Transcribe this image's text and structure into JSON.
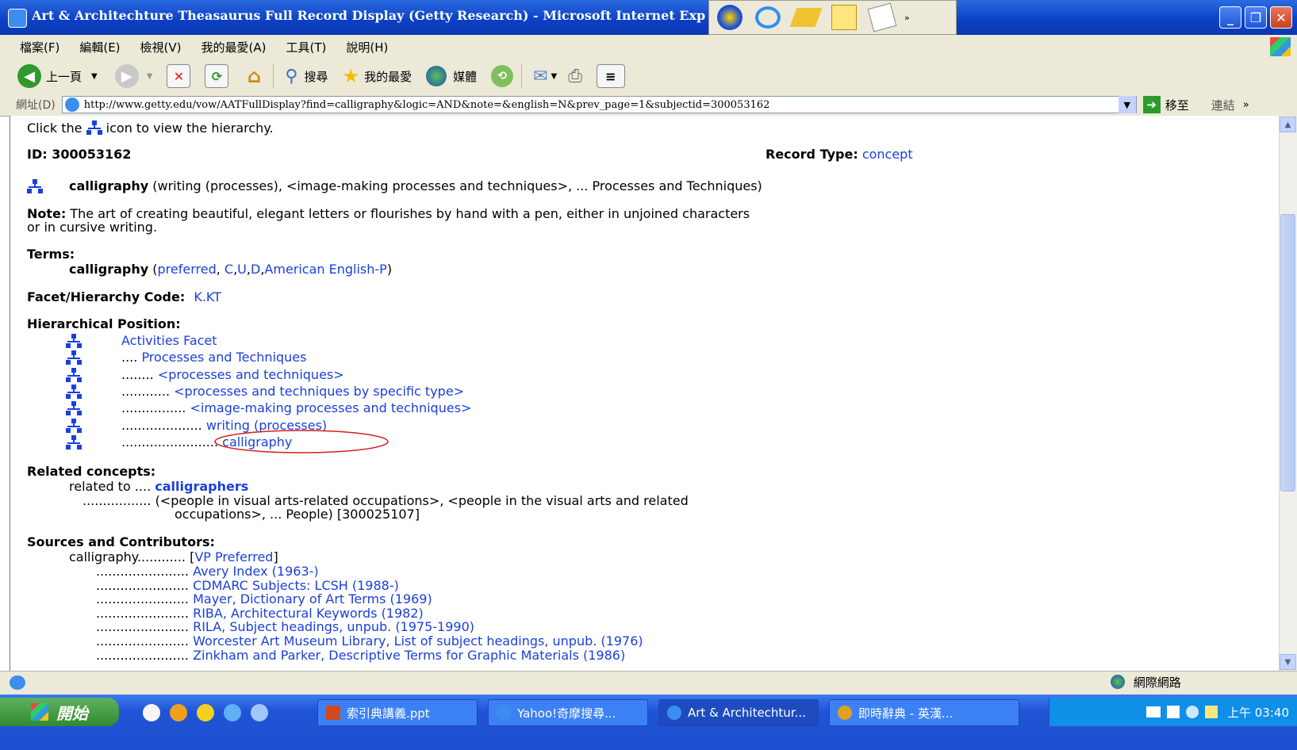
{
  "window": {
    "title": "Art & Architechture Theasaurus Full Record Display (Getty Research) - Microsoft Internet Exp"
  },
  "menu": [
    "檔案(F)",
    "編輯(E)",
    "檢視(V)",
    "我的最愛(A)",
    "工具(T)",
    "說明(H)"
  ],
  "toolbar": {
    "back": "上一頁",
    "search": "搜尋",
    "favorites": "我的最愛",
    "media": "媒體"
  },
  "address": {
    "label": "網址(D)",
    "url": "http://www.getty.edu/vow/AATFullDisplay?find=calligraphy&logic=AND&note=&english=N&prev_page=1&subjectid=300053162",
    "go": "移至",
    "links": "連結"
  },
  "record": {
    "intro_pre": "Click the",
    "intro_post": "icon to view the hierarchy.",
    "id_label": "ID: 300053162",
    "record_type_label": "Record Type:",
    "record_type_value": "concept",
    "heading_term": "calligraphy",
    "heading_context": "(writing (processes), <image-making processes and techniques>, ... Processes and Techniques)",
    "note_label": "Note:",
    "note_line1": "The art of creating beautiful, elegant letters or flourishes by hand with a pen, either in unjoined characters",
    "note_line2": "or in cursive writing.",
    "terms_label": "Terms:",
    "term": "calligraphy",
    "term_open": "(",
    "term_flags": [
      {
        "text": "preferred",
        "sep": ", "
      },
      {
        "text": "C",
        "sep": ","
      },
      {
        "text": "U",
        "sep": ","
      },
      {
        "text": "D",
        "sep": ","
      },
      {
        "text": "American English-P",
        "sep": ""
      }
    ],
    "term_close": ")",
    "facet_label": "Facet/Hierarchy Code:",
    "facet_code": "K.KT",
    "hier_label": "Hierarchical Position:",
    "hierarchy": [
      {
        "dots": "",
        "text": "Activities Facet"
      },
      {
        "dots": "....",
        "text": "Processes and Techniques"
      },
      {
        "dots": "........",
        "text": "<processes and techniques>"
      },
      {
        "dots": "............",
        "text": "<processes and techniques by specific type>"
      },
      {
        "dots": "................",
        "text": "<image-making processes and techniques>"
      },
      {
        "dots": "....................",
        "text": "writing (processes)"
      },
      {
        "dots": "........................",
        "text": "calligraphy"
      }
    ],
    "related_label": "Related concepts:",
    "related_to": "related to ....",
    "related_term": "calligraphers",
    "related_dots": ".................",
    "related_desc1": "(<people in visual arts-related occupations>, <people in the visual arts and related",
    "related_desc2": "occupations>, ... People) [300025107]",
    "sources_label": "Sources and Contributors:",
    "source_term": "calligraphy............",
    "source_pref_open": "[",
    "source_pref": "VP Preferred",
    "source_pref_close": "]",
    "sources": [
      {
        "dots": ".......................",
        "text": "Avery Index (1963-)"
      },
      {
        "dots": ".......................",
        "text": "CDMARC Subjects: LCSH (1988-)"
      },
      {
        "dots": ".......................",
        "text": "Mayer, Dictionary of Art Terms (1969)"
      },
      {
        "dots": ".......................",
        "text": "RIBA, Architectural Keywords (1982)"
      },
      {
        "dots": ".......................",
        "text": "RILA, Subject headings, unpub. (1975-1990)"
      },
      {
        "dots": ".......................",
        "text": "Worcester Art Museum Library, List of subject headings, unpub. (1976)"
      },
      {
        "dots": ".......................",
        "text": "Zinkham and Parker, Descriptive Terms for Graphic Materials (1986)"
      }
    ]
  },
  "status": {
    "zone": "網際網路"
  },
  "taskbar": {
    "start": "開始",
    "tasks": [
      "索引典講義.ppt",
      "Yahoo!奇摩搜尋...",
      "Art & Architechtur...",
      "即時辭典 - 英漢..."
    ],
    "clock": "上午 03:40"
  },
  "colors": {
    "link": "#1a3fdd",
    "highlight_ellipse": "#d42020",
    "titlebar": "#0b3fc4"
  }
}
